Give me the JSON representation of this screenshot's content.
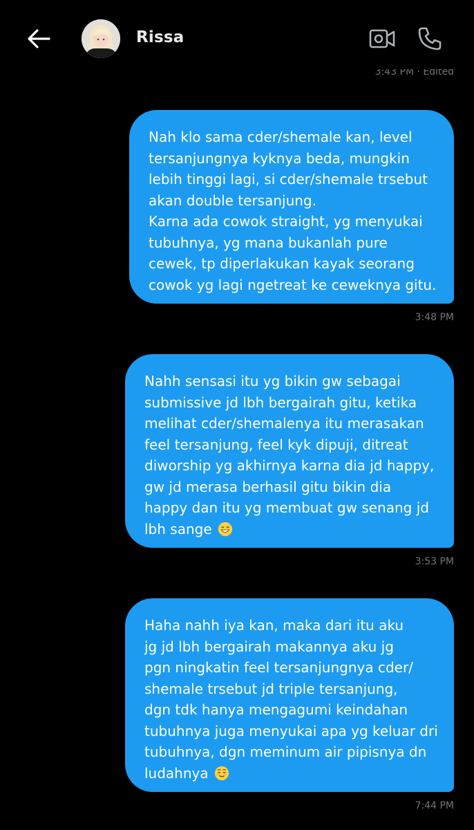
{
  "header": {
    "contact_name": "Rissa",
    "back_icon": "arrow-left-icon",
    "video_icon": "video-camera-icon",
    "call_icon": "phone-icon"
  },
  "previous_message": {
    "timestamp": "3:43 PM · Edited"
  },
  "messages": [
    {
      "lines": [
        "Nah klo sama cder/shemale kan, level",
        "tersanjungnya kyknya beda, mungkin",
        "lebih tinggi lagi, si cder/shemale trsebut",
        "akan double tersanjung.",
        "Karna ada cowok straight, yg menyukai",
        "tubuhnya, yg mana bukanlah pure",
        "cewek, tp diperlakukan kayak seorang",
        "cowok yg lagi ngetreat ke ceweknya gitu."
      ],
      "timestamp": "3:48 PM"
    },
    {
      "lines": [
        "Nahh sensasi itu yg bikin gw sebagai",
        "submissive jd lbh bergairah gitu, ketika",
        "melihat cder/shemalenya itu merasakan",
        "feel tersanjung, feel kyk dipuji, ditreat",
        "diworship yg akhirnya karna dia jd happy,",
        "gw jd merasa berhasil gitu bikin dia",
        "happy dan itu yg membuat gw senang  jd",
        "lbh sange"
      ],
      "emoji": "grinning-sweat-emoji",
      "timestamp": "3:53 PM"
    },
    {
      "lines": [
        "Haha nahh iya kan, maka dari itu aku",
        "jg jd lbh bergairah makannya aku jg",
        "pgn ningkatin feel tersanjungnya cder/",
        "shemale trsebut jd triple tersanjung,",
        "dgn tdk hanya mengagumi keindahan",
        "tubuhnya juga menyukai apa yg keluar dri",
        "tubuhnya, dgn meminum air pipisnya dn",
        "ludahnya"
      ],
      "emoji": "relieved-face-emoji",
      "timestamp": "7:44 PM"
    }
  ],
  "colors": {
    "background": "#000000",
    "bubble": "#1d9bf0",
    "timestamp": "#71767b",
    "name": "#e7e9ea"
  }
}
